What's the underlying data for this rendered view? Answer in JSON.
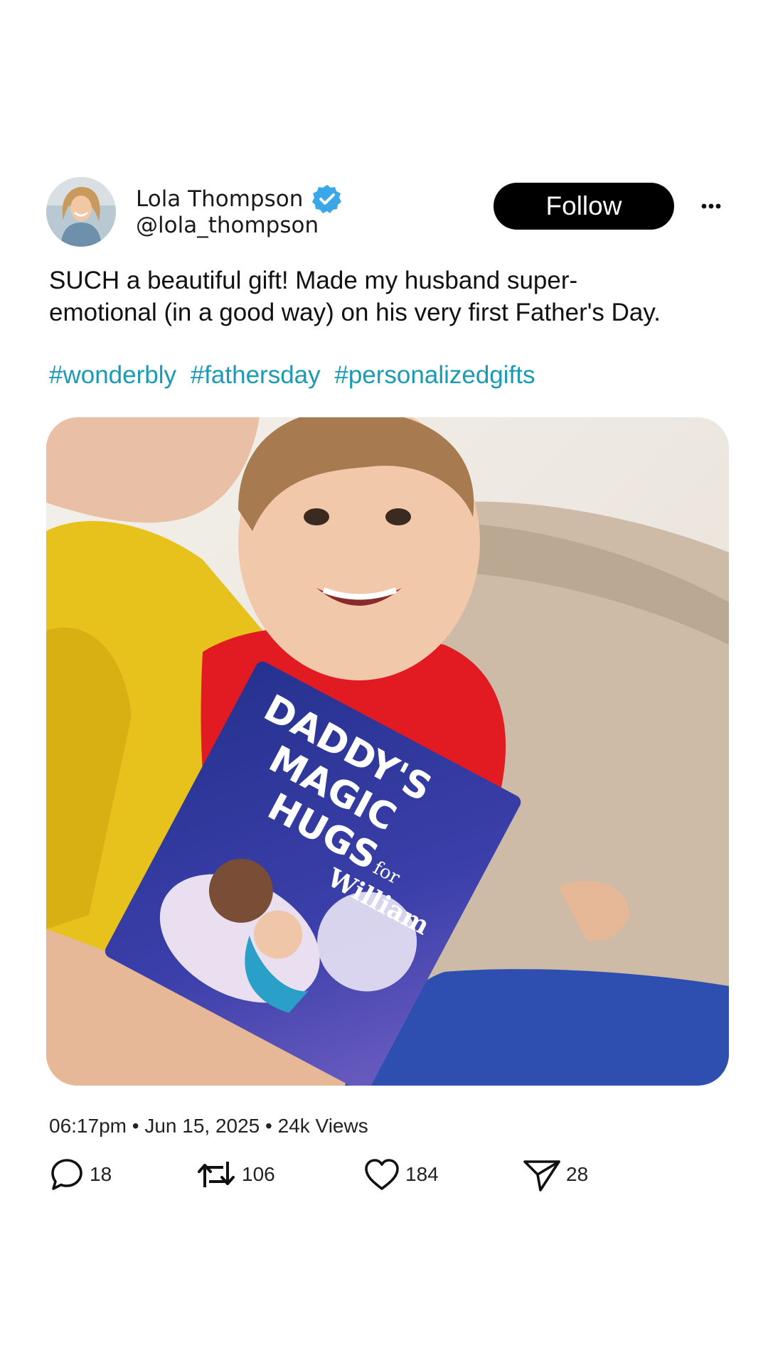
{
  "author": {
    "name": "Lola Thompson",
    "handle": "@lola_thompson",
    "verified": true
  },
  "follow_label": "Follow",
  "post": {
    "text_line1": "SUCH a beautiful gift! Made my husband super-",
    "text_line2": "emotional (in a good way) on his very first Father's Day.",
    "hashtags": [
      "#wonderbly",
      "#fathersday",
      "#personalizedgifts"
    ]
  },
  "photo": {
    "book_title_line1": "DADDY'S",
    "book_title_line2": "MAGIC",
    "book_title_line3": "HUGS",
    "book_for": "for",
    "book_name": "William"
  },
  "meta": "06:17pm • Jun 15, 2025 • 24k Views",
  "actions": {
    "replies": "18",
    "reposts": "106",
    "likes": "184",
    "shares": "28"
  },
  "colors": {
    "hashtag": "#1a9bb5",
    "verified": "#3aa8e8",
    "follow_bg": "#000000"
  }
}
